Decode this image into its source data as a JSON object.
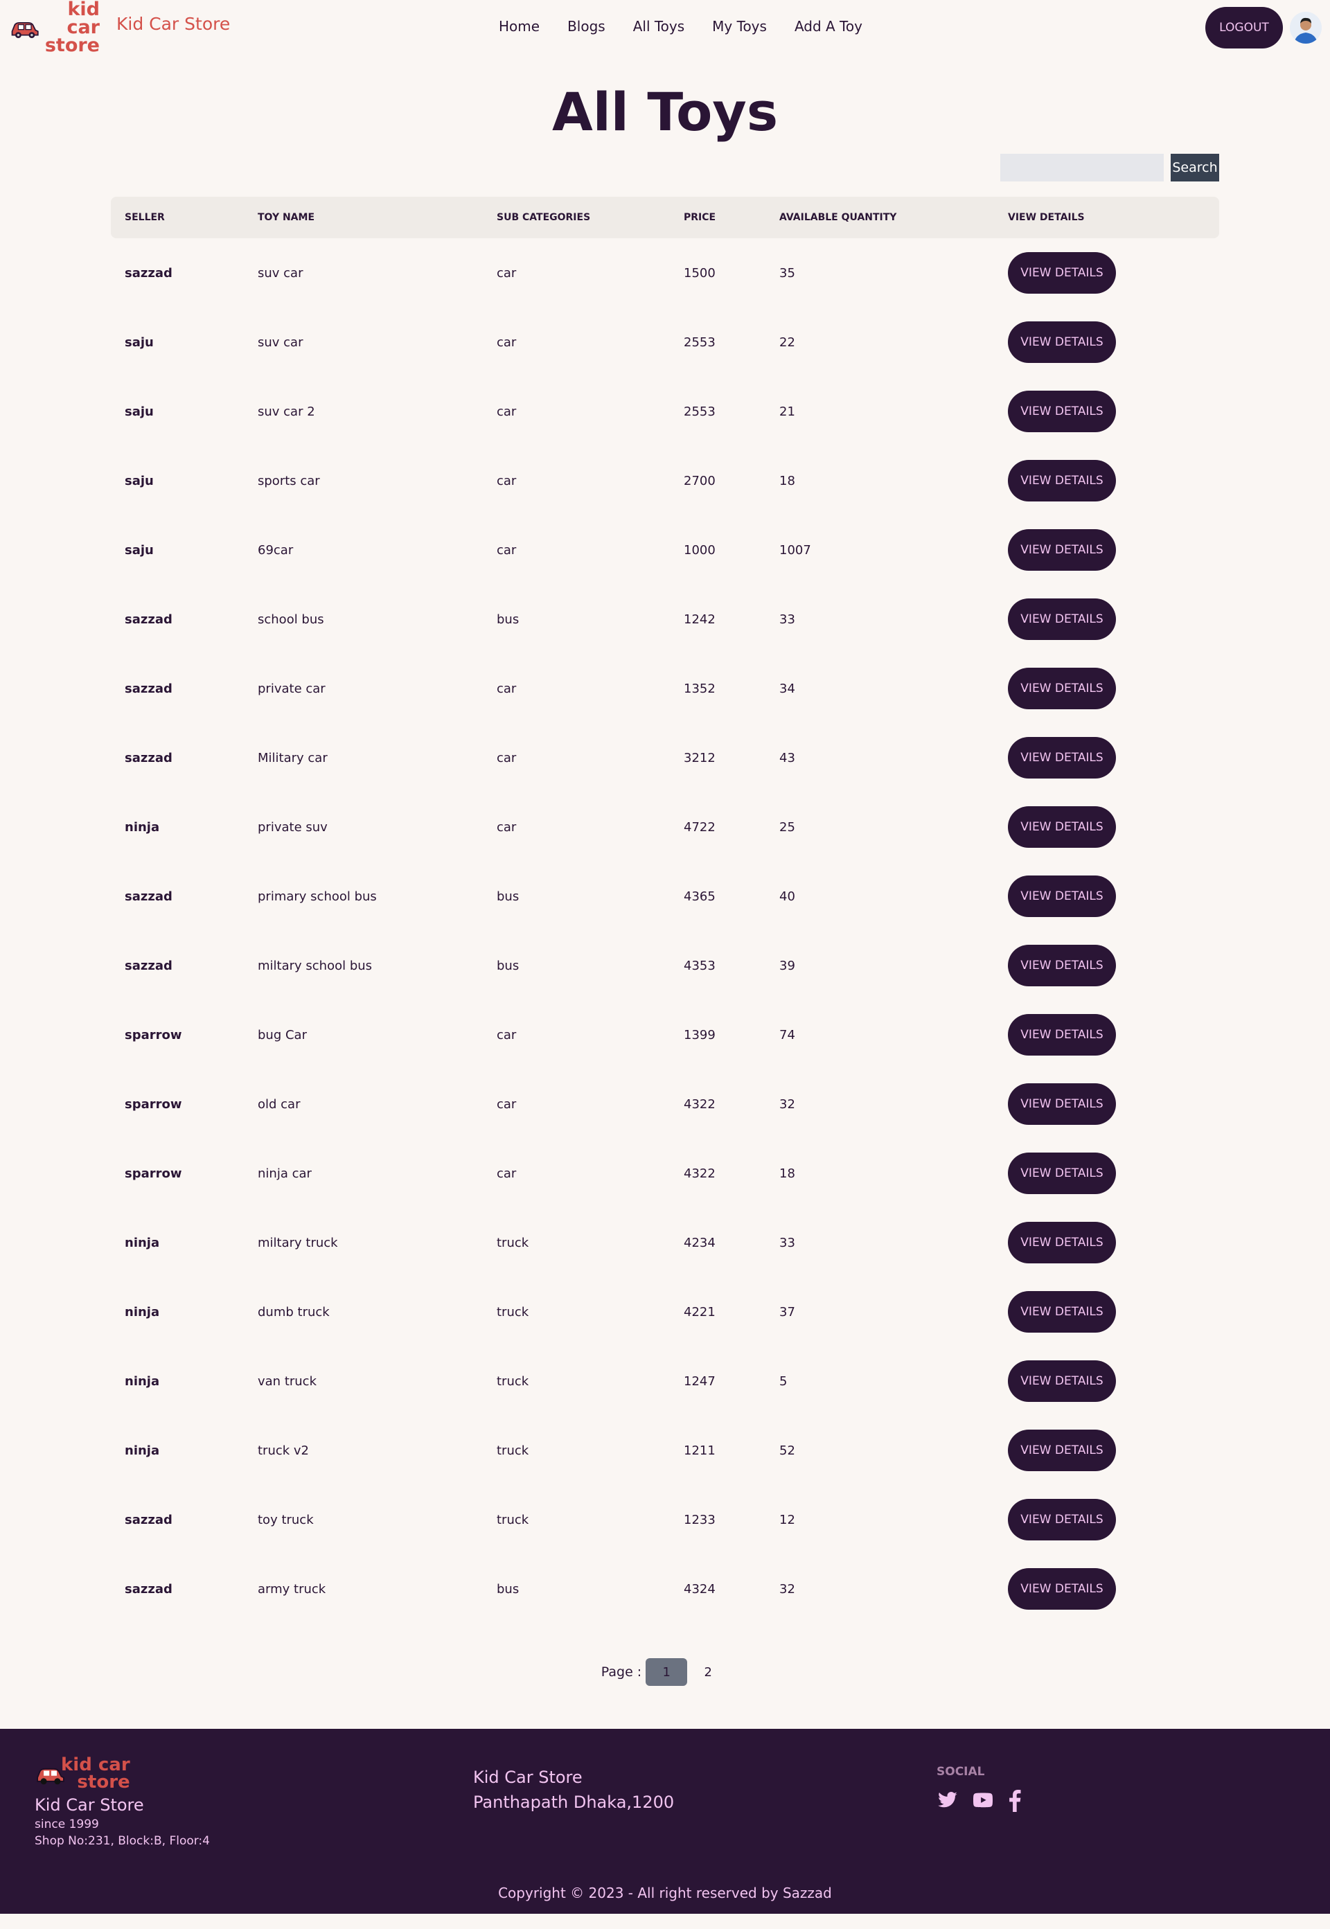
{
  "header": {
    "logo_line1": "kid car",
    "logo_line2": "store",
    "brand_name": "Kid Car Store",
    "nav": [
      "Home",
      "Blogs",
      "All Toys",
      "My Toys",
      "Add A Toy"
    ],
    "logout_label": "LOGOUT"
  },
  "main": {
    "title": "All Toys",
    "search_placeholder": "",
    "search_button": "Search",
    "columns": [
      "SELLER",
      "TOY NAME",
      "SUB CATEGORIES",
      "PRICE",
      "AVAILABLE QUANTITY",
      "VIEW DETAILS"
    ],
    "view_label": "VIEW DETAILS",
    "rows": [
      [
        "sazzad",
        "suv car",
        "car",
        "1500",
        "35"
      ],
      [
        "saju",
        "suv car",
        "car",
        "2553",
        "22"
      ],
      [
        "saju",
        "suv car 2",
        "car",
        "2553",
        "21"
      ],
      [
        "saju",
        "sports car",
        "car",
        "2700",
        "18"
      ],
      [
        "saju",
        "69car",
        "car",
        "1000",
        "1007"
      ],
      [
        "sazzad",
        "school bus",
        "bus",
        "1242",
        "33"
      ],
      [
        "sazzad",
        "private car",
        "car",
        "1352",
        "34"
      ],
      [
        "sazzad",
        "Military car",
        "car",
        "3212",
        "43"
      ],
      [
        "ninja",
        "private suv",
        "car",
        "4722",
        "25"
      ],
      [
        "sazzad",
        "primary school bus",
        "bus",
        "4365",
        "40"
      ],
      [
        "sazzad",
        "miltary school bus",
        "bus",
        "4353",
        "39"
      ],
      [
        "sparrow",
        "bug Car",
        "car",
        "1399",
        "74"
      ],
      [
        "sparrow",
        "old car",
        "car",
        "4322",
        "32"
      ],
      [
        "sparrow",
        "ninja car",
        "car",
        "4322",
        "18"
      ],
      [
        "ninja",
        "miltary truck",
        "truck",
        "4234",
        "33"
      ],
      [
        "ninja",
        "dumb truck",
        "truck",
        "4221",
        "37"
      ],
      [
        "ninja",
        "van truck",
        "truck",
        "1247",
        "5"
      ],
      [
        "ninja",
        "truck v2",
        "truck",
        "1211",
        "52"
      ],
      [
        "sazzad",
        "toy truck",
        "truck",
        "1233",
        "12"
      ],
      [
        "sazzad",
        "army truck",
        "bus",
        "4324",
        "32"
      ]
    ],
    "pagination": {
      "label": "Page :",
      "pages": [
        "1",
        "2"
      ],
      "active": "1"
    }
  },
  "footer": {
    "logo_line1": "kid car",
    "logo_line2": "store",
    "name": "Kid Car Store",
    "since": "since 1999",
    "shop": "Shop No:231, Block:B, Floor:4",
    "address_line1": "Kid Car Store",
    "address_line2": "Panthapath Dhaka,1200",
    "social_title": "SOCIAL",
    "social_icons": [
      "twitter-icon",
      "youtube-icon",
      "facebook-icon"
    ],
    "copyright": "Copyright © 2023 - All right reserved by Sazzad"
  },
  "colors": {
    "background": "#faf6f3",
    "primary": "#2a1535",
    "button_text": "#f2c4f0",
    "brand_red": "#d4514a",
    "table_header_bg": "#efebe7",
    "search_button_bg": "#374151"
  }
}
